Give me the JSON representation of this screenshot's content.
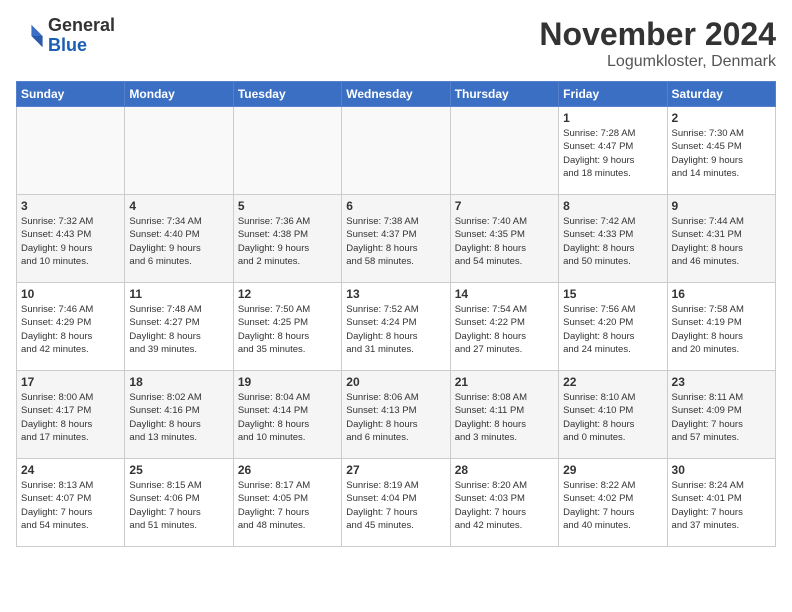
{
  "header": {
    "logo_general": "General",
    "logo_blue": "Blue",
    "month_title": "November 2024",
    "location": "Logumkloster, Denmark"
  },
  "weekdays": [
    "Sunday",
    "Monday",
    "Tuesday",
    "Wednesday",
    "Thursday",
    "Friday",
    "Saturday"
  ],
  "weeks": [
    [
      {
        "day": "",
        "info": ""
      },
      {
        "day": "",
        "info": ""
      },
      {
        "day": "",
        "info": ""
      },
      {
        "day": "",
        "info": ""
      },
      {
        "day": "",
        "info": ""
      },
      {
        "day": "1",
        "info": "Sunrise: 7:28 AM\nSunset: 4:47 PM\nDaylight: 9 hours\nand 18 minutes."
      },
      {
        "day": "2",
        "info": "Sunrise: 7:30 AM\nSunset: 4:45 PM\nDaylight: 9 hours\nand 14 minutes."
      }
    ],
    [
      {
        "day": "3",
        "info": "Sunrise: 7:32 AM\nSunset: 4:43 PM\nDaylight: 9 hours\nand 10 minutes."
      },
      {
        "day": "4",
        "info": "Sunrise: 7:34 AM\nSunset: 4:40 PM\nDaylight: 9 hours\nand 6 minutes."
      },
      {
        "day": "5",
        "info": "Sunrise: 7:36 AM\nSunset: 4:38 PM\nDaylight: 9 hours\nand 2 minutes."
      },
      {
        "day": "6",
        "info": "Sunrise: 7:38 AM\nSunset: 4:37 PM\nDaylight: 8 hours\nand 58 minutes."
      },
      {
        "day": "7",
        "info": "Sunrise: 7:40 AM\nSunset: 4:35 PM\nDaylight: 8 hours\nand 54 minutes."
      },
      {
        "day": "8",
        "info": "Sunrise: 7:42 AM\nSunset: 4:33 PM\nDaylight: 8 hours\nand 50 minutes."
      },
      {
        "day": "9",
        "info": "Sunrise: 7:44 AM\nSunset: 4:31 PM\nDaylight: 8 hours\nand 46 minutes."
      }
    ],
    [
      {
        "day": "10",
        "info": "Sunrise: 7:46 AM\nSunset: 4:29 PM\nDaylight: 8 hours\nand 42 minutes."
      },
      {
        "day": "11",
        "info": "Sunrise: 7:48 AM\nSunset: 4:27 PM\nDaylight: 8 hours\nand 39 minutes."
      },
      {
        "day": "12",
        "info": "Sunrise: 7:50 AM\nSunset: 4:25 PM\nDaylight: 8 hours\nand 35 minutes."
      },
      {
        "day": "13",
        "info": "Sunrise: 7:52 AM\nSunset: 4:24 PM\nDaylight: 8 hours\nand 31 minutes."
      },
      {
        "day": "14",
        "info": "Sunrise: 7:54 AM\nSunset: 4:22 PM\nDaylight: 8 hours\nand 27 minutes."
      },
      {
        "day": "15",
        "info": "Sunrise: 7:56 AM\nSunset: 4:20 PM\nDaylight: 8 hours\nand 24 minutes."
      },
      {
        "day": "16",
        "info": "Sunrise: 7:58 AM\nSunset: 4:19 PM\nDaylight: 8 hours\nand 20 minutes."
      }
    ],
    [
      {
        "day": "17",
        "info": "Sunrise: 8:00 AM\nSunset: 4:17 PM\nDaylight: 8 hours\nand 17 minutes."
      },
      {
        "day": "18",
        "info": "Sunrise: 8:02 AM\nSunset: 4:16 PM\nDaylight: 8 hours\nand 13 minutes."
      },
      {
        "day": "19",
        "info": "Sunrise: 8:04 AM\nSunset: 4:14 PM\nDaylight: 8 hours\nand 10 minutes."
      },
      {
        "day": "20",
        "info": "Sunrise: 8:06 AM\nSunset: 4:13 PM\nDaylight: 8 hours\nand 6 minutes."
      },
      {
        "day": "21",
        "info": "Sunrise: 8:08 AM\nSunset: 4:11 PM\nDaylight: 8 hours\nand 3 minutes."
      },
      {
        "day": "22",
        "info": "Sunrise: 8:10 AM\nSunset: 4:10 PM\nDaylight: 8 hours\nand 0 minutes."
      },
      {
        "day": "23",
        "info": "Sunrise: 8:11 AM\nSunset: 4:09 PM\nDaylight: 7 hours\nand 57 minutes."
      }
    ],
    [
      {
        "day": "24",
        "info": "Sunrise: 8:13 AM\nSunset: 4:07 PM\nDaylight: 7 hours\nand 54 minutes."
      },
      {
        "day": "25",
        "info": "Sunrise: 8:15 AM\nSunset: 4:06 PM\nDaylight: 7 hours\nand 51 minutes."
      },
      {
        "day": "26",
        "info": "Sunrise: 8:17 AM\nSunset: 4:05 PM\nDaylight: 7 hours\nand 48 minutes."
      },
      {
        "day": "27",
        "info": "Sunrise: 8:19 AM\nSunset: 4:04 PM\nDaylight: 7 hours\nand 45 minutes."
      },
      {
        "day": "28",
        "info": "Sunrise: 8:20 AM\nSunset: 4:03 PM\nDaylight: 7 hours\nand 42 minutes."
      },
      {
        "day": "29",
        "info": "Sunrise: 8:22 AM\nSunset: 4:02 PM\nDaylight: 7 hours\nand 40 minutes."
      },
      {
        "day": "30",
        "info": "Sunrise: 8:24 AM\nSunset: 4:01 PM\nDaylight: 7 hours\nand 37 minutes."
      }
    ]
  ]
}
